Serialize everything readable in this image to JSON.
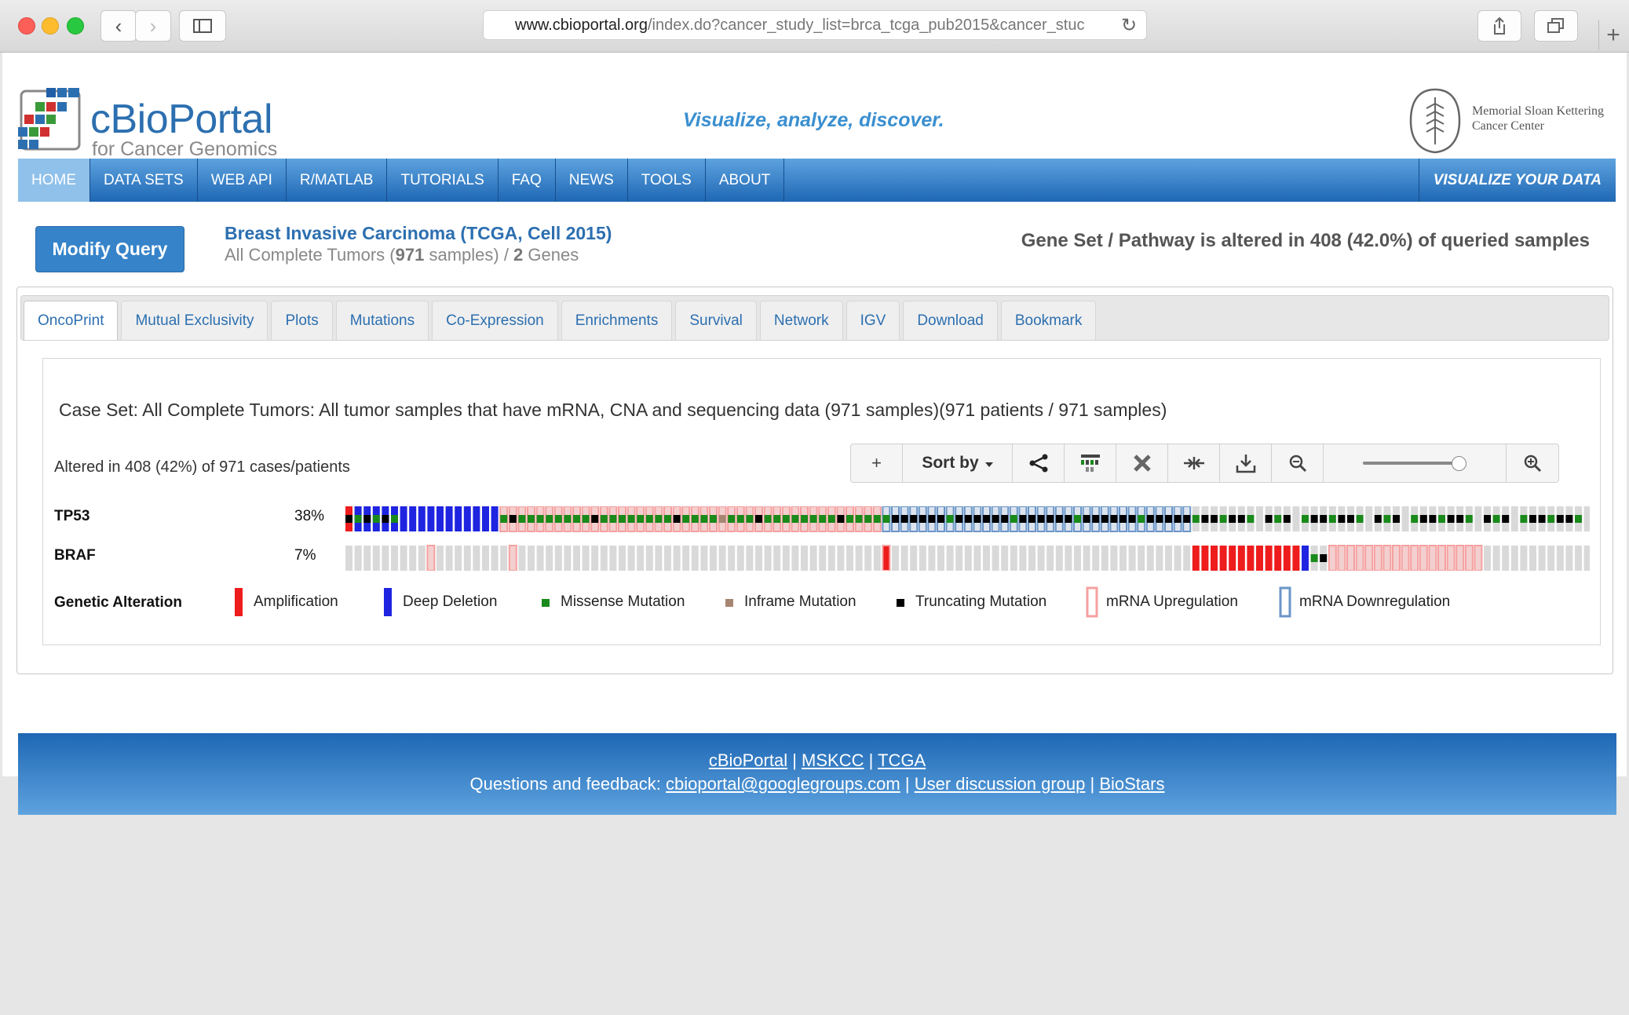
{
  "browser": {
    "url_host": "www.cbioportal.org",
    "url_path": "/index.do?cancer_study_list=brca_tcga_pub2015&cancer_stuc"
  },
  "header": {
    "logo_title": "cBioPortal",
    "logo_subtitle": "for Cancer Genomics",
    "tagline": "Visualize, analyze, discover.",
    "partner_line1": "Memorial Sloan Kettering",
    "partner_line2": "Cancer Center"
  },
  "nav": {
    "items": [
      "HOME",
      "DATA SETS",
      "WEB API",
      "R/MATLAB",
      "TUTORIALS",
      "FAQ",
      "NEWS",
      "TOOLS",
      "ABOUT"
    ],
    "active": "HOME",
    "visualize": "VISUALIZE YOUR DATA"
  },
  "query": {
    "modify_label": "Modify Query",
    "study_title": "Breast Invasive Carcinoma (TCGA, Cell 2015)",
    "study_prefix": "All Complete Tumors (",
    "study_samples": "971",
    "study_mid": " samples) / ",
    "study_genes": "2",
    "study_suffix": " Genes",
    "altered_summary": "Gene Set / Pathway is altered in 408 (42.0%) of queried samples"
  },
  "tabs": [
    "OncoPrint",
    "Mutual Exclusivity",
    "Plots",
    "Mutations",
    "Co-Expression",
    "Enrichments",
    "Survival",
    "Network",
    "IGV",
    "Download",
    "Bookmark"
  ],
  "oncoprint": {
    "case_set": "Case Set: All Complete Tumors: All tumor samples that have mRNA, CNA and sequencing data (971 samples)(971 patients / 971 samples)",
    "altered_text": "Altered in 408 (42%) of 971 cases/patients",
    "toolbar": {
      "add": "+",
      "sort_label": "Sort by",
      "zoom_level": 0.9
    },
    "genes": [
      {
        "name": "TP53",
        "pct": "38%"
      },
      {
        "name": "BRAF",
        "pct": "7%"
      }
    ],
    "legend_title": "Genetic Alteration",
    "legend": [
      {
        "label": "Amplification",
        "color": "#ee1c1c"
      },
      {
        "label": "Deep Deletion",
        "color": "#1f24e0"
      },
      {
        "label": "Missense Mutation",
        "color": "#1a8a1a"
      },
      {
        "label": "Inframe Mutation",
        "color": "#a78573"
      },
      {
        "label": "Truncating Mutation",
        "color": "#000000"
      },
      {
        "label": "mRNA Upregulation",
        "color": "#f5a0a0"
      },
      {
        "label": "mRNA Downregulation",
        "color": "#6a96c8"
      }
    ]
  },
  "footer": {
    "links1": [
      "cBioPortal",
      "MSKCC",
      "TCGA"
    ],
    "feedback_prefix": "Questions and feedback: ",
    "links2": [
      "cbioportal@googlegroups.com",
      "User discussion group",
      "BioStars"
    ]
  }
}
